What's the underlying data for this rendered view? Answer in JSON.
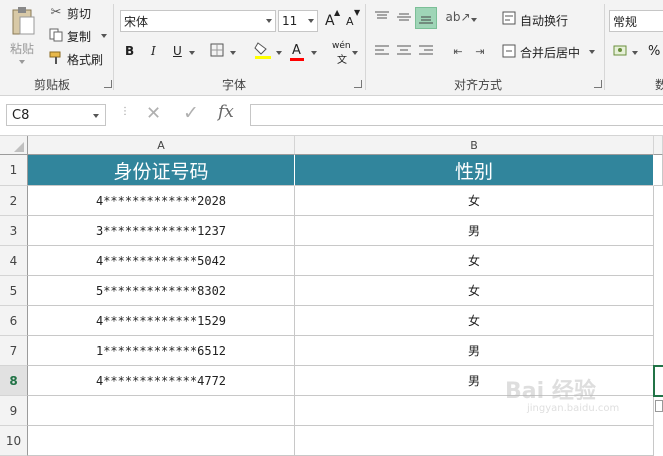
{
  "clipboard": {
    "paste_label": "粘贴",
    "cut_label": "剪切",
    "copy_label": "复制",
    "format_painter_label": "格式刷",
    "group_label": "剪贴板"
  },
  "font": {
    "font_name": "宋体",
    "font_size": "11",
    "bold": "B",
    "italic": "I",
    "underline": "U",
    "increase": "A",
    "decrease": "A",
    "phonetic": "wén",
    "phonetic_sub": "文",
    "group_label": "字体"
  },
  "alignment": {
    "wrap_label": "自动换行",
    "merge_label": "合并后居中",
    "group_label": "对齐方式"
  },
  "number": {
    "format_value": "常规",
    "percent": "%",
    "group_label_partial": "数"
  },
  "formula_bar": {
    "name_box": "C8",
    "cancel_symbol": "✕",
    "enter_symbol": "✓",
    "fx_symbol": "fx",
    "formula": ""
  },
  "sheet": {
    "column_headers": [
      "A",
      "B"
    ],
    "row_numbers": [
      "1",
      "2",
      "3",
      "4",
      "5",
      "6",
      "7",
      "8",
      "9",
      "10"
    ],
    "header_row": [
      "身份证号码",
      "性别"
    ],
    "rows": [
      [
        "4*************2028",
        "女"
      ],
      [
        "3*************1237",
        "男"
      ],
      [
        "4*************5042",
        "女"
      ],
      [
        "5*************8302",
        "女"
      ],
      [
        "4*************1529",
        "女"
      ],
      [
        "1*************6512",
        "男"
      ],
      [
        "4*************4772",
        "男"
      ]
    ],
    "active_row": "8",
    "header_fill_color": "#31859c"
  },
  "watermark": {
    "text": "Bai 经验",
    "url_text": "jingyan.baidu.com"
  }
}
